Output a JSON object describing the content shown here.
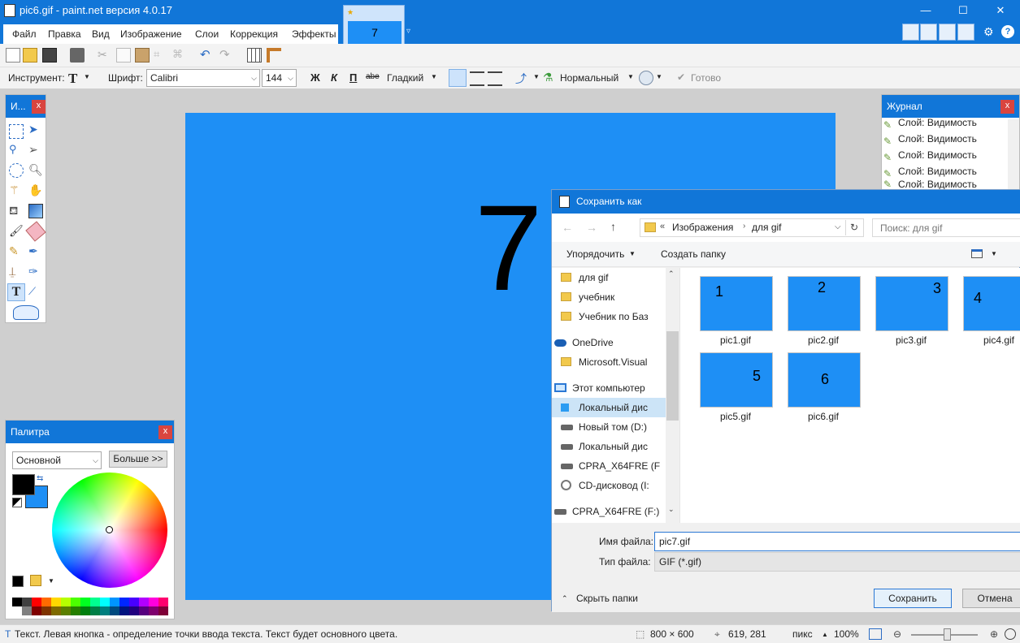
{
  "app": {
    "title": "pic6.gif - paint.net версия 4.0.17",
    "window_controls": {
      "minimize": "—",
      "maximize": "☐",
      "close": "✕"
    }
  },
  "menu": {
    "items": [
      "Файл",
      "Правка",
      "Вид",
      "Изображение",
      "Слои",
      "Коррекция",
      "Эффекты"
    ]
  },
  "image_tab": {
    "label": "7"
  },
  "toolbar2": {
    "tool_label": "Инструмент:",
    "font_label": "Шрифт:",
    "font_value": "Calibri",
    "size_value": "144",
    "bold": "Ж",
    "italic": "К",
    "underline": "П",
    "strike": "abe",
    "antialias": "Гладкий",
    "blend": "Нормальный",
    "finish": "Готово"
  },
  "canvas": {
    "text": "7",
    "color": "#1e8ff5"
  },
  "tools_window": {
    "title": "И...",
    "close": "x"
  },
  "history": {
    "title": "Журнал",
    "close": "x",
    "items": [
      "Слой: Видимость",
      "Слой: Видимость",
      "Слой: Видимость",
      "Слой: Видимость",
      "Слой: Видимость"
    ]
  },
  "palette": {
    "title": "Палитра",
    "close": "x",
    "mode": "Основной",
    "more": "Больше >>",
    "primary_color": "#000000",
    "secondary_color": "#1e8ff5"
  },
  "dialog": {
    "title": "Сохранить как",
    "path": [
      "Изображения",
      "для gif"
    ],
    "path_prefix": "«",
    "search_placeholder": "Поиск: для gif",
    "organize": "Упорядочить",
    "new_folder": "Создать папку",
    "nav": [
      {
        "label": "для gif",
        "icon": "folder"
      },
      {
        "label": "учебник",
        "icon": "folder"
      },
      {
        "label": "Учебник по Баз",
        "icon": "folder"
      },
      {
        "label": "OneDrive",
        "icon": "cloud"
      },
      {
        "label": "Microsoft.Visual",
        "icon": "folder"
      },
      {
        "label": "Этот компьютер",
        "icon": "computer"
      },
      {
        "label": "Локальный дис",
        "icon": "windows-drive"
      },
      {
        "label": "Новый том (D:)",
        "icon": "drive"
      },
      {
        "label": "Локальный дис",
        "icon": "drive"
      },
      {
        "label": "CPRA_X64FRE (F",
        "icon": "drive"
      },
      {
        "label": "CD-дисковод (I:",
        "icon": "cd"
      },
      {
        "label": "CPRA_X64FRE (F:)",
        "icon": "drive"
      }
    ],
    "files": [
      {
        "name": "pic1.gif",
        "digit": "1"
      },
      {
        "name": "pic2.gif",
        "digit": "2"
      },
      {
        "name": "pic3.gif",
        "digit": "3"
      },
      {
        "name": "pic4.gif",
        "digit": "4"
      },
      {
        "name": "pic5.gif",
        "digit": "5"
      },
      {
        "name": "pic6.gif",
        "digit": "6"
      }
    ],
    "filename_label": "Имя файла:",
    "filename_value": "pic7.gif",
    "filetype_label": "Тип файла:",
    "filetype_value": "GIF (*.gif)",
    "hide_folders": "Скрыть папки",
    "save": "Сохранить",
    "cancel": "Отмена"
  },
  "status": {
    "hint": "Текст. Левая кнопка - определение точки ввода текста. Текст будет основного цвета.",
    "size": "800 × 600",
    "cursor": "619, 281",
    "units": "пикс",
    "zoom": "100%"
  }
}
